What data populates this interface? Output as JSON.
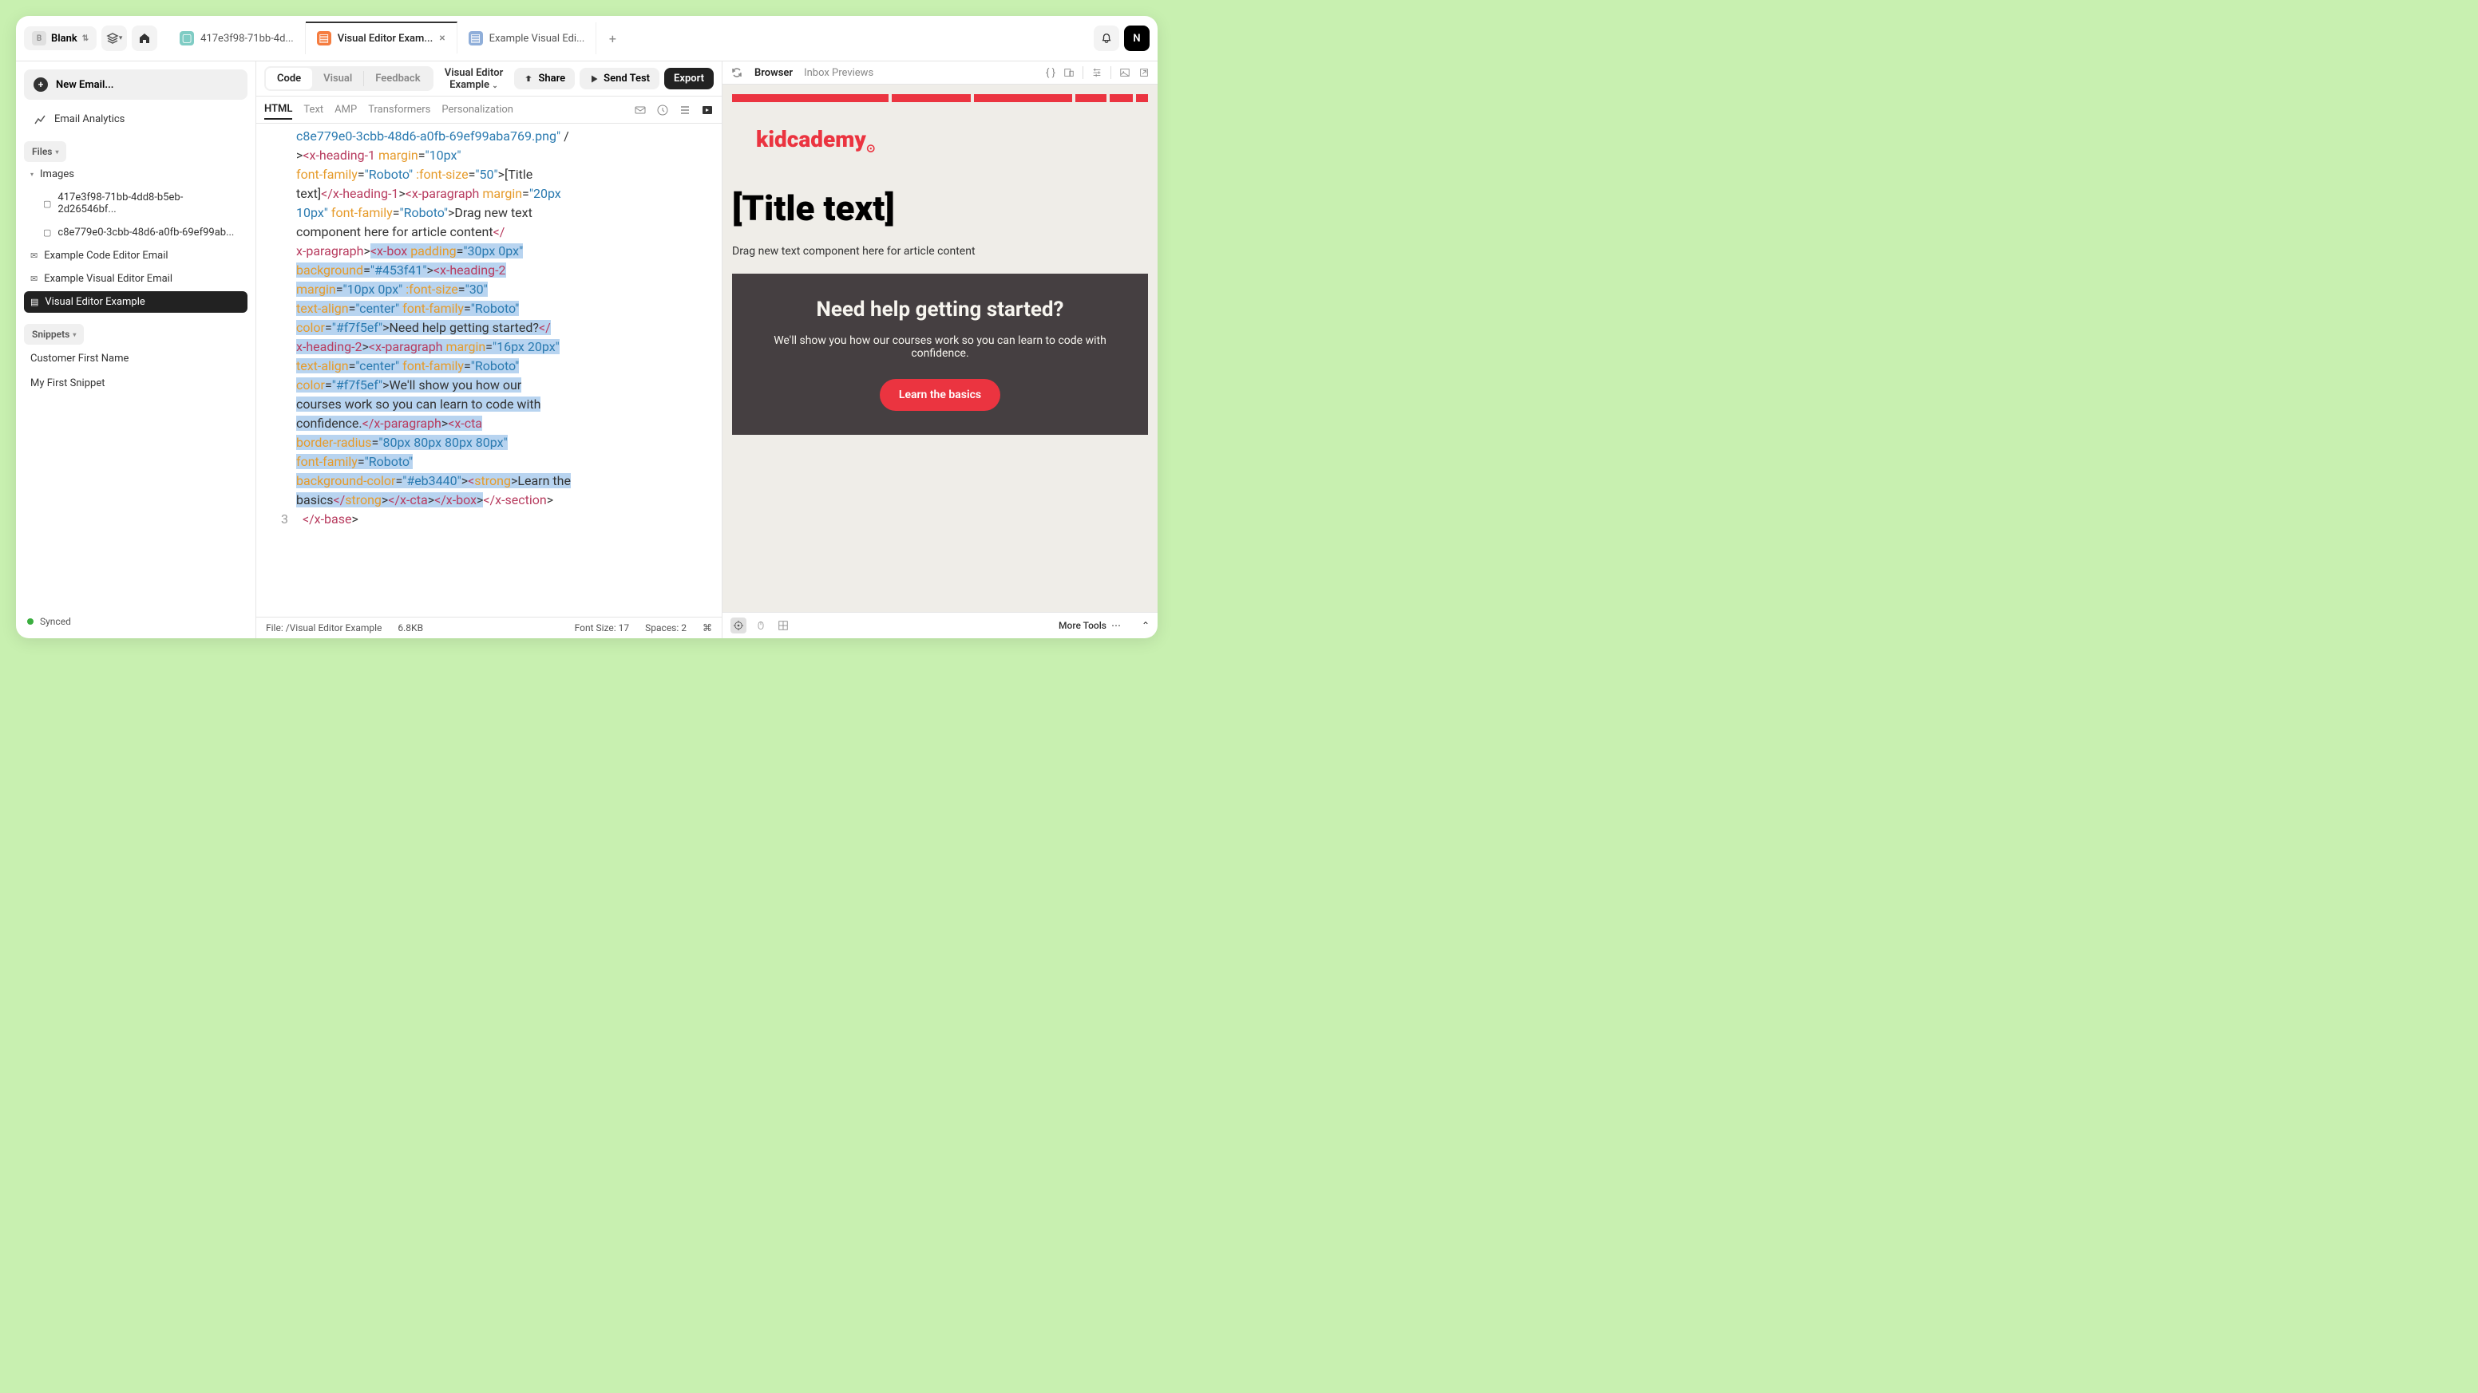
{
  "workspace": {
    "name": "Blank",
    "letter": "B"
  },
  "user": {
    "initial": "N"
  },
  "tabs": [
    {
      "label": "417e3f98-71bb-4d...",
      "icon": "teal",
      "active": false
    },
    {
      "label": "Visual Editor Exam...",
      "icon": "orange",
      "active": true
    },
    {
      "label": "Example Visual Edi...",
      "icon": "blue",
      "active": false
    }
  ],
  "sidebar": {
    "new_email": "New Email...",
    "analytics": "Email Analytics",
    "files_label": "Files",
    "images_label": "Images",
    "images": [
      "417e3f98-71bb-4dd8-b5eb-2d26546bf...",
      "c8e779e0-3cbb-48d6-a0fb-69ef99ab..."
    ],
    "files": [
      "Example Code Editor Email",
      "Example Visual Editor Email",
      "Visual Editor Example"
    ],
    "snippets_label": "Snippets",
    "snippets": [
      "Customer First Name",
      "My First Snippet"
    ],
    "synced": "Synced"
  },
  "toolbar": {
    "segments": [
      "Code",
      "Visual",
      "Feedback"
    ],
    "title": "Visual Editor Example",
    "share": "Share",
    "send_test": "Send Test",
    "export": "Export"
  },
  "subtabs": [
    "HTML",
    "Text",
    "AMP",
    "Transformers",
    "Personalization"
  ],
  "code": {
    "gutter_line": "3",
    "line1_a": "c8e779e0-3cbb-48d6-a0fb-69ef99aba769.png\"",
    "line1_b": " /",
    "line2_a": ">",
    "line2_b": "<",
    "line2_c": "x-heading-1 ",
    "line2_d": "margin",
    "line2_e": "=",
    "line2_f": "\"10px\"",
    "line3_a": "font-family",
    "line3_b": "=",
    "line3_c": "\"Roboto\" ",
    "line3_d": ":font-size",
    "line3_e": "=",
    "line3_f": "\"50\"",
    "line3_g": ">",
    "line3_h": "[Title",
    "line4_a": "text]",
    "line4_b": "</",
    "line4_c": "x-heading-1",
    "line4_d": ">",
    "line4_e": "<",
    "line4_f": "x-paragraph ",
    "line4_g": "margin",
    "line4_h": "=",
    "line4_i": "\"20px",
    "line5_a": "10px\" ",
    "line5_b": "font-family",
    "line5_c": "=",
    "line5_d": "\"Roboto\"",
    "line5_e": ">",
    "line5_f": "Drag new text",
    "line6_a": "component here for article content",
    "line6_b": "</",
    "line7_a": "x-paragraph",
    "line7_b": ">",
    "line7_c": "<",
    "line7_d": "x-box ",
    "line7_e": "padding",
    "line7_f": "=",
    "line7_g": "\"30px 0px\"",
    "line8_a": "background",
    "line8_b": "=",
    "line8_c": "\"#453f41\"",
    "line8_d": ">",
    "line8_e": "<",
    "line8_f": "x-heading-2",
    "line9_a": "margin",
    "line9_b": "=",
    "line9_c": "\"10px 0px\" ",
    "line9_d": ":font-size",
    "line9_e": "=",
    "line9_f": "\"30\"",
    "line10_a": "text-align",
    "line10_b": "=",
    "line10_c": "\"center\" ",
    "line10_d": "font-family",
    "line10_e": "=",
    "line10_f": "\"Roboto\"",
    "line11_a": "color",
    "line11_b": "=",
    "line11_c": "\"#f7f5ef\"",
    "line11_d": ">",
    "line11_e": "Need help getting started?",
    "line11_f": "</",
    "line12_a": "x-heading-2",
    "line12_b": ">",
    "line12_c": "<",
    "line12_d": "x-paragraph ",
    "line12_e": "margin",
    "line12_f": "=",
    "line12_g": "\"16px 20px\"",
    "line13_a": "text-align",
    "line13_b": "=",
    "line13_c": "\"center\" ",
    "line13_d": "font-family",
    "line13_e": "=",
    "line13_f": "\"Roboto\"",
    "line14_a": "color",
    "line14_b": "=",
    "line14_c": "\"#f7f5ef\"",
    "line14_d": ">",
    "line14_e": "We'll show you how our",
    "line15_a": "courses work so you can learn to code with",
    "line16_a": "confidence.",
    "line16_b": "</",
    "line16_c": "x-paragraph",
    "line16_d": ">",
    "line16_e": "<",
    "line16_f": "x-cta",
    "line17_a": "border-radius",
    "line17_b": "=",
    "line17_c": "\"80px 80px 80px 80px\"",
    "line18_a": "font-family",
    "line18_b": "=",
    "line18_c": "\"Roboto\"",
    "line19_a": "background-color",
    "line19_b": "=",
    "line19_c": "\"#eb3440\"",
    "line19_d": ">",
    "line19_e": "<",
    "line19_f": "strong",
    "line19_g": ">",
    "line19_h": "Learn the",
    "line20_a": "basics",
    "line20_b": "</",
    "line20_c": "strong",
    "line20_d": ">",
    "line20_e": "</",
    "line20_f": "x-cta",
    "line20_g": ">",
    "line20_h": "</",
    "line20_i": "x-box",
    "line20_j": ">",
    "line20_k": "</",
    "line20_l": "x-section",
    "line20_m": ">",
    "line21_a": "</",
    "line21_b": "x-base",
    "line21_c": ">"
  },
  "status_bar": {
    "file": "File: /Visual Editor Example",
    "size": "6.8KB",
    "font_size": "Font Size: 17",
    "spaces": "Spaces: 2",
    "shortcut": "⌘"
  },
  "preview": {
    "browser": "Browser",
    "inbox": "Inbox Previews",
    "logo": "kidcademy",
    "title": "[Title text]",
    "para": "Drag new text component here for article content",
    "cta_heading": "Need help getting started?",
    "cta_para": "We'll show you how our courses work so you can learn to code with confidence.",
    "cta_button": "Learn the basics",
    "more_tools": "More Tools"
  }
}
